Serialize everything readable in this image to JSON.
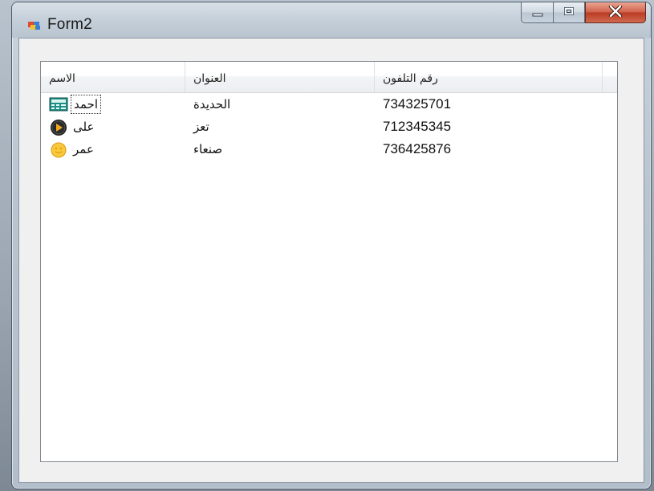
{
  "window": {
    "title": "Form2",
    "icon": "form-app-icon",
    "caption_buttons": [
      "minimize-icon",
      "maximize-icon",
      "close-icon"
    ]
  },
  "listview": {
    "columns": [
      "الاسم",
      "العنوان",
      "رقم التلفون"
    ],
    "rows": [
      {
        "name": "احمد",
        "icon": "calculator-icon",
        "address": "الحديدة",
        "phone": "734325701",
        "focused": true
      },
      {
        "name": "على",
        "icon": "media-player-icon",
        "address": "تعز",
        "phone": "712345345",
        "focused": false
      },
      {
        "name": "عمر",
        "icon": "smiley-face-icon",
        "address": "صنعاء",
        "phone": "736425876",
        "focused": false
      }
    ]
  },
  "colors": {
    "close_button": "#c9462d",
    "list_background": "#ffffff",
    "client_background": "#f0f0f0"
  }
}
